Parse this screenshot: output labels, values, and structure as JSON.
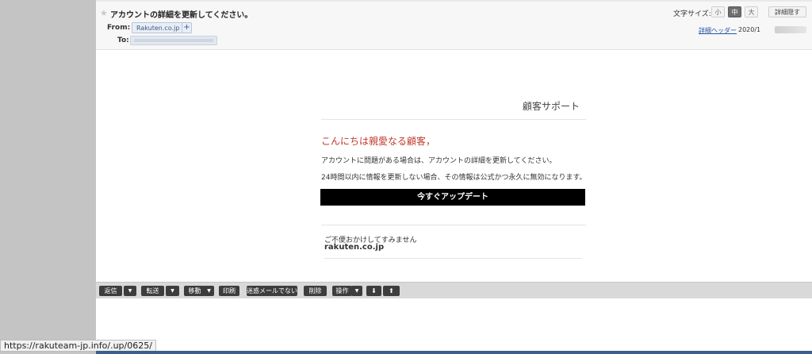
{
  "header": {
    "subject": "アカウントの詳細を更新してください。",
    "from_label": "From:",
    "from_value": "Rakuten.co.jp",
    "add_button": "+",
    "to_label": "To:",
    "font_size_label": "文字サイズ:",
    "font_sizes": [
      "小",
      "中",
      "大"
    ],
    "font_size_selected": "中",
    "hide_details_label": "詳細隠す",
    "detail_header_link": "詳細ヘッダー",
    "date_visible": "2020/1"
  },
  "email": {
    "support_title": "顧客サポート",
    "greeting": "こんにちは親愛なる顧客，",
    "line1": "アカウントに問題がある場合は、アカウントの詳細を更新してください。",
    "line2": "24時間以内に情報を更新しない場合、その情報は公式かつ永久に無効になります。",
    "update_button": "今すぐアップデート",
    "apology": "ご不便おかけしてすみません",
    "signature": "rakuten.co.jp",
    "accent_color": "#c0392b"
  },
  "toolbar": {
    "reply": "返信",
    "forward": "転送",
    "move": "移動",
    "print": "印刷",
    "not_spam": "迷惑メールでない",
    "delete": "削除",
    "actions": "操作",
    "down_arrow": "⬇",
    "up_arrow": "⬆",
    "caret": "▼"
  },
  "status_bar": {
    "url": "https://rakuteam-jp.info/.up/0625/"
  }
}
